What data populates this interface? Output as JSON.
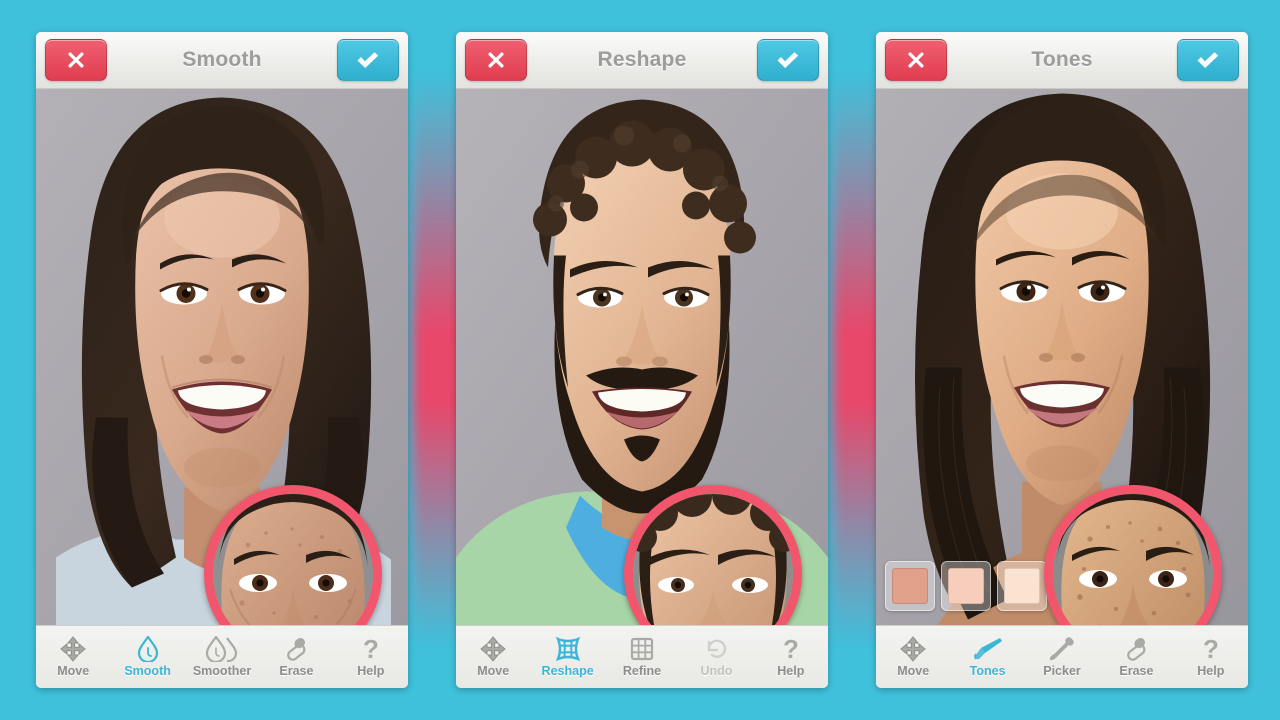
{
  "theme": {
    "background": "#3FC1DC",
    "glow": "#FF3C5F",
    "accent": "#3BB6D6",
    "cancel_red": "#E8505F",
    "confirm_cyan": "#3BBBD8",
    "loupe_ring": "#F2566C",
    "panel_bg": "#EFEFED",
    "label_gray": "#8D8D8D",
    "title_gray": "#9C9C9C",
    "disabled_gray": "#C2C2BE"
  },
  "panels": [
    {
      "id": "smooth",
      "header": {
        "title": "Smooth",
        "cancel_icon": "close-x-icon",
        "confirm_icon": "check-icon"
      },
      "photo": {
        "subject": "woman-smiling-portrait-after",
        "loupe": {
          "label": "before-preview-loupe",
          "subject": "woman-smiling-portrait-before"
        }
      },
      "tools": [
        {
          "label": "Move",
          "icon": "move-arrows-icon",
          "state": "normal"
        },
        {
          "label": "Smooth",
          "icon": "droplet-icon",
          "state": "active"
        },
        {
          "label": "Smoother",
          "icon": "double-droplet-icon",
          "state": "normal"
        },
        {
          "label": "Erase",
          "icon": "eraser-icon",
          "state": "normal"
        },
        {
          "label": "Help",
          "icon": "question-mark-icon",
          "state": "normal"
        }
      ]
    },
    {
      "id": "reshape",
      "header": {
        "title": "Reshape",
        "cancel_icon": "close-x-icon",
        "confirm_icon": "check-icon"
      },
      "photo": {
        "subject": "bearded-man-smiling-portrait-after",
        "loupe": {
          "label": "before-preview-loupe",
          "subject": "bearded-man-smiling-portrait-before"
        }
      },
      "tools": [
        {
          "label": "Move",
          "icon": "move-arrows-icon",
          "state": "normal"
        },
        {
          "label": "Reshape",
          "icon": "warp-grid-icon",
          "state": "active"
        },
        {
          "label": "Refine",
          "icon": "fine-grid-icon",
          "state": "normal"
        },
        {
          "label": "Undo",
          "icon": "undo-arrow-icon",
          "state": "disabled"
        },
        {
          "label": "Help",
          "icon": "question-mark-icon",
          "state": "normal"
        }
      ]
    },
    {
      "id": "tones",
      "header": {
        "title": "Tones",
        "cancel_icon": "close-x-icon",
        "confirm_icon": "check-icon"
      },
      "photo": {
        "subject": "woman-dark-hair-smiling-portrait-after",
        "loupe": {
          "label": "before-preview-loupe",
          "subject": "woman-dark-hair-smiling-portrait-before"
        },
        "swatches": [
          {
            "name": "tone-swatch-1",
            "color": "#E0A08A",
            "selected": true
          },
          {
            "name": "tone-swatch-2",
            "color": "#F7CDBC",
            "selected": false
          },
          {
            "name": "tone-swatch-3",
            "color": "#FBE3D2",
            "selected": false
          }
        ]
      },
      "tools": [
        {
          "label": "Move",
          "icon": "move-arrows-icon",
          "state": "normal"
        },
        {
          "label": "Tones",
          "icon": "brush-icon",
          "state": "active"
        },
        {
          "label": "Picker",
          "icon": "eyedropper-icon",
          "state": "normal"
        },
        {
          "label": "Erase",
          "icon": "eraser-icon",
          "state": "normal"
        },
        {
          "label": "Help",
          "icon": "question-mark-icon",
          "state": "normal"
        }
      ]
    }
  ]
}
